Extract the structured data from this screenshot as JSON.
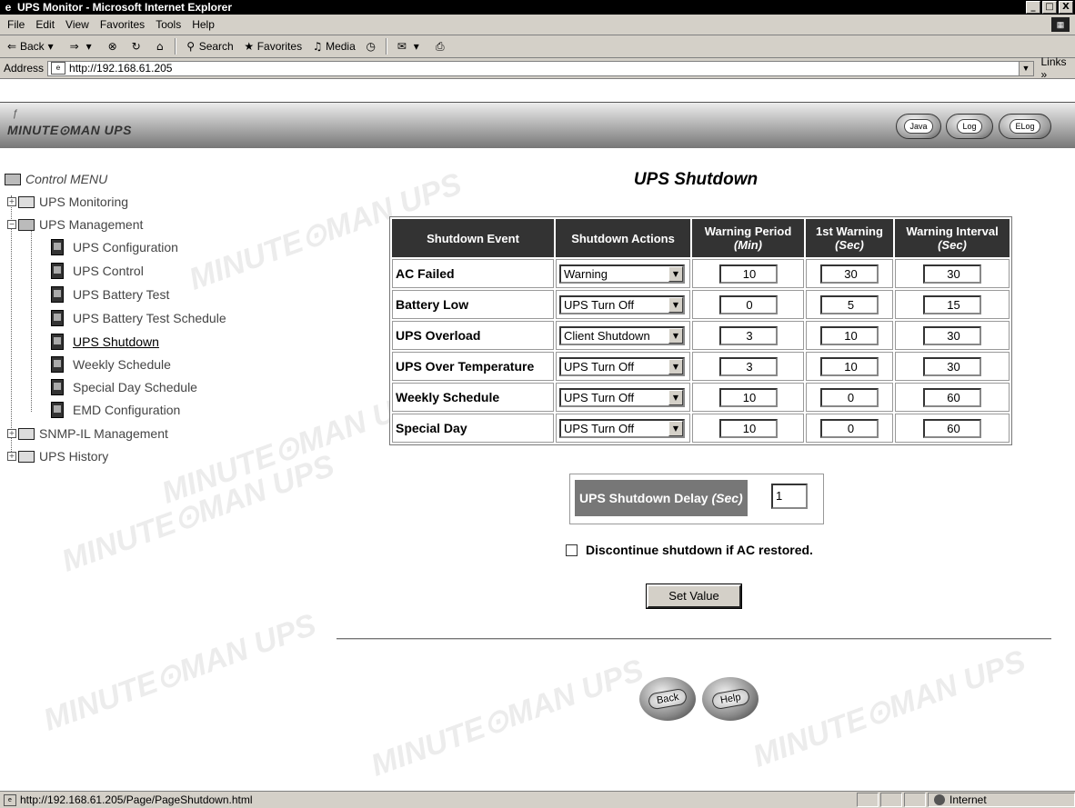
{
  "window": {
    "title": "UPS Monitor - Microsoft Internet Explorer",
    "min": "_",
    "max": "□",
    "close": "X"
  },
  "menubar": [
    "File",
    "Edit",
    "View",
    "Favorites",
    "Tools",
    "Help"
  ],
  "toolbar": {
    "back": "Back",
    "search": "Search",
    "favorites": "Favorites",
    "media": "Media"
  },
  "address": {
    "label": "Address",
    "url": "http://192.168.61.205",
    "links": "Links »"
  },
  "header": {
    "logo": "MINUTE⊙MAN UPS",
    "buttons": [
      "Java",
      "Log",
      "ELog"
    ]
  },
  "leftmenu": {
    "root": "Control MENU",
    "items": [
      "UPS Monitoring",
      "UPS Management",
      "UPS Configuration",
      "UPS Control",
      "UPS Battery Test",
      "UPS Battery Test Schedule",
      "UPS Shutdown",
      "Weekly Schedule",
      "Special Day Schedule",
      "EMD Configuration",
      "SNMP-IL Management",
      "UPS History"
    ]
  },
  "watermark": "MINUTE⊙MAN UPS",
  "main": {
    "title": "UPS Shutdown",
    "headers": {
      "event": "Shutdown Event",
      "action": "Shutdown Actions",
      "period": "Warning Period",
      "period_unit": "(Min)",
      "first": "1st Warning",
      "first_unit": "(Sec)",
      "interval": "Warning Interval",
      "interval_unit": "(Sec)"
    },
    "rows": [
      {
        "event": "AC Failed",
        "action": "Warning",
        "period": "10",
        "first": "30",
        "interval": "30"
      },
      {
        "event": "Battery Low",
        "action": "UPS Turn Off",
        "period": "0",
        "first": "5",
        "interval": "15"
      },
      {
        "event": "UPS Overload",
        "action": "Client Shutdown",
        "period": "3",
        "first": "10",
        "interval": "30"
      },
      {
        "event": "UPS Over Temperature",
        "action": "UPS Turn Off",
        "period": "3",
        "first": "10",
        "interval": "30"
      },
      {
        "event": "Weekly Schedule",
        "action": "UPS Turn Off",
        "period": "10",
        "first": "0",
        "interval": "60"
      },
      {
        "event": "Special Day",
        "action": "UPS Turn Off",
        "period": "10",
        "first": "0",
        "interval": "60"
      }
    ],
    "delay": {
      "label": "UPS Shutdown Delay",
      "unit": "(Sec)",
      "value": "1"
    },
    "discontinue": "Discontinue shutdown if AC restored.",
    "set_button": "Set Value",
    "back_button": "Back",
    "help_button": "Help"
  },
  "status": {
    "text": "http://192.168.61.205/Page/PageShutdown.html",
    "zone": "Internet"
  }
}
